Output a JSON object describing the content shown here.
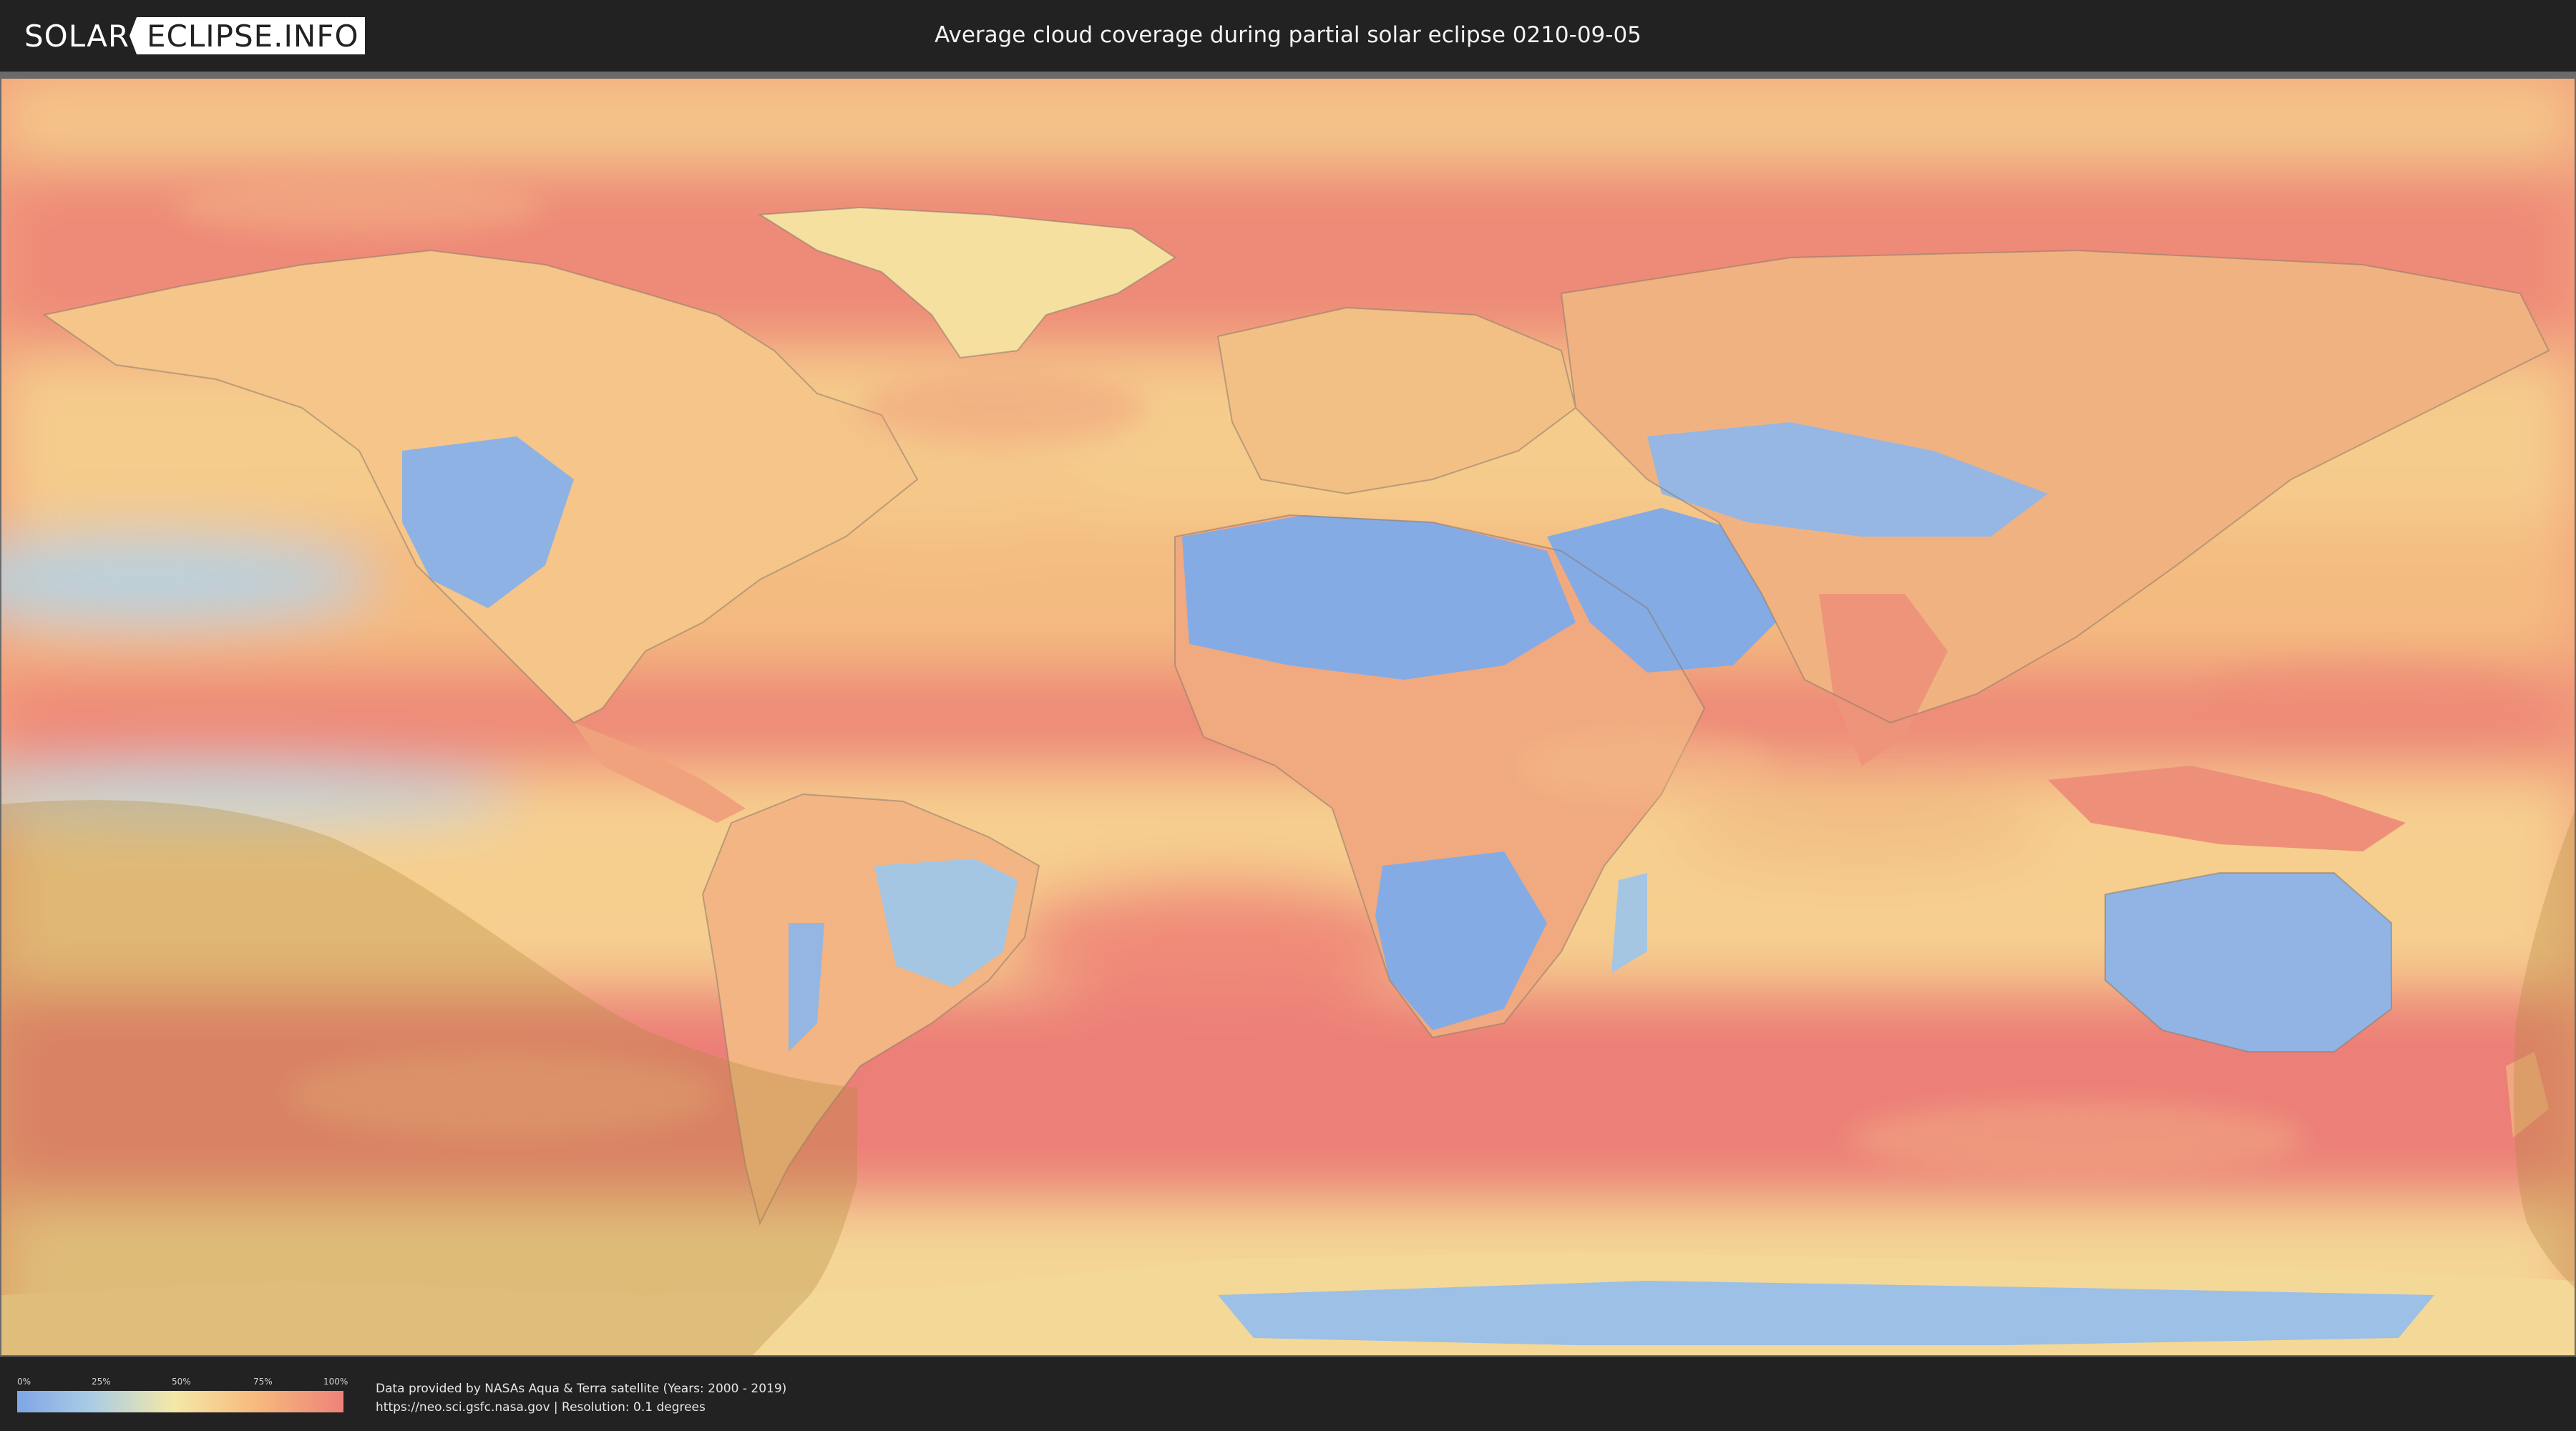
{
  "header": {
    "logo_part1": "SOLAR",
    "logo_part2": "ECLIPSE.INFO",
    "title": "Average cloud coverage during partial solar eclipse 0210-09-05"
  },
  "map": {
    "palette": {
      "clear": "#7fa6e6",
      "light": "#a8cbe6",
      "medium": "#f4e8a8",
      "heavy": "#f7bc7e",
      "overcast": "#ee8279",
      "eclipse_overlay": "#b08a3a",
      "coastline": "#8a7a6a"
    }
  },
  "legend": {
    "labels": [
      "0%",
      "25%",
      "50%",
      "75%",
      "100%"
    ]
  },
  "footer": {
    "line1": "Data provided by NASAs Aqua & Terra satellite (Years: 2000 - 2019)",
    "line2": "https://neo.sci.gsfc.nasa.gov | Resolution: 0.1 degrees"
  }
}
